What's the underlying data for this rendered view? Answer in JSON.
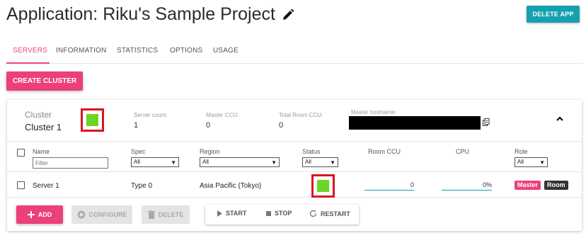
{
  "page": {
    "title": "Application: Riku's Sample Project",
    "delete_app_label": "DELETE APP"
  },
  "tabs": [
    {
      "label": "SERVERS",
      "active": true
    },
    {
      "label": "INFORMATION",
      "active": false
    },
    {
      "label": "STATISTICS",
      "active": false
    },
    {
      "label": "OPTIONS",
      "active": false
    },
    {
      "label": "USAGE",
      "active": false
    }
  ],
  "create_cluster_label": "CREATE CLUSTER",
  "cluster": {
    "cluster_label": "Cluster",
    "name": "Cluster 1",
    "server_count_label": "Server count:",
    "server_count": "1",
    "master_ccu_label": "Master CCU:",
    "master_ccu": "0",
    "total_room_ccu_label": "Total Room CCU:",
    "total_room_ccu": "0",
    "master_hostname_label": "Master hostname:"
  },
  "table": {
    "headers": {
      "name": "Name",
      "spec": "Spec",
      "region": "Region",
      "status": "Status",
      "room_ccu": "Room CCU",
      "cpu": "CPU",
      "role": "Role"
    },
    "filter_placeholder": "Filter",
    "spec_filter": "All",
    "region_filter": "All",
    "status_filter": "All",
    "role_filter": "All",
    "rows": [
      {
        "name": "Server 1",
        "spec": "Type 0",
        "region": "Asia Pacific (Tokyo)",
        "room_ccu": "0",
        "cpu": "0%",
        "roles": [
          "Master",
          "Room"
        ]
      }
    ]
  },
  "actions": {
    "add": "ADD",
    "configure": "CONFIGURE",
    "delete": "DELETE",
    "start": "START",
    "stop": "STOP",
    "restart": "RESTART"
  },
  "colors": {
    "accent_pink": "#ec407a",
    "teal": "#14a0ae",
    "status_green": "#6ad628",
    "highlight_red": "#d9161f",
    "role_dark": "#333333"
  },
  "icons": [
    "pencil-icon",
    "copy-icon",
    "chevron-up-icon",
    "plus-icon",
    "gear-icon",
    "trash-icon",
    "play-icon",
    "stop-icon",
    "refresh-icon"
  ]
}
